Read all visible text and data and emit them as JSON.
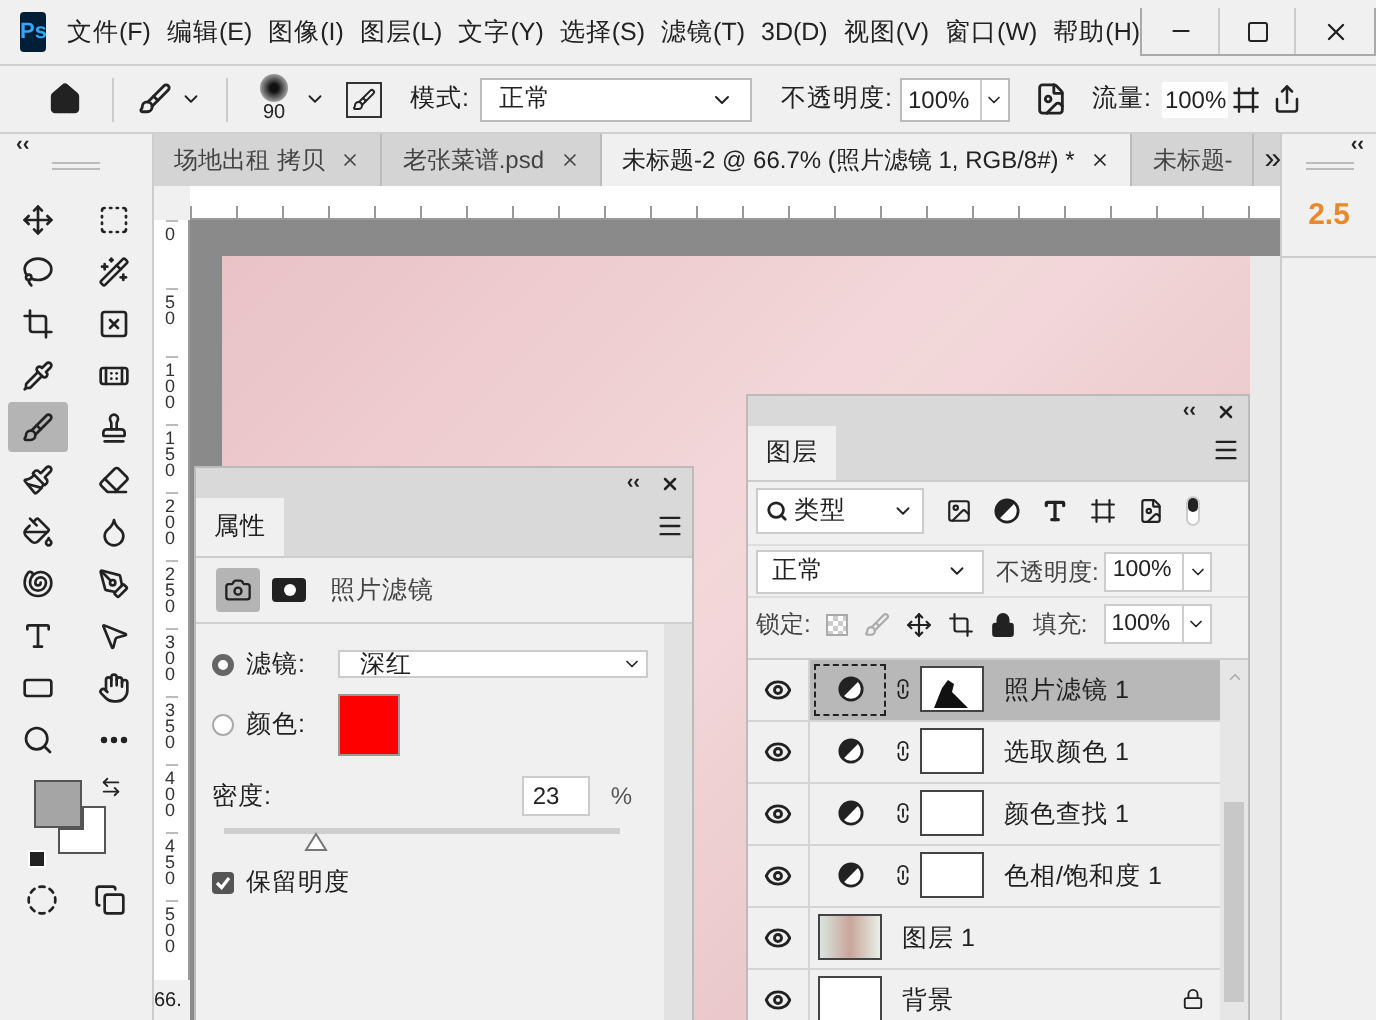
{
  "app_logo": "Ps",
  "menu": [
    "文件(F)",
    "编辑(E)",
    "图像(I)",
    "图层(L)",
    "文字(Y)",
    "选择(S)",
    "滤镜(T)",
    "3D(D)",
    "视图(V)",
    "窗口(W)",
    "帮助(H)"
  ],
  "options_bar": {
    "brush_size": "90",
    "mode_label": "模式:",
    "mode_value": "正常",
    "opacity_label": "不透明度:",
    "opacity_value": "100%",
    "flow_label": "流量:",
    "flow_value": "100%"
  },
  "tabs": [
    {
      "label": "场地出租 拷贝",
      "selected": false
    },
    {
      "label": "老张菜谱.psd",
      "selected": false
    },
    {
      "label": "未标题-2 @ 66.7% (照片滤镜 1, RGB/8#) *",
      "selected": true
    },
    {
      "label": "未标题-",
      "selected": false
    }
  ],
  "tabs_overflow": "»",
  "collapse_glyph": "‹‹",
  "right_panel_value": "2.5",
  "tools": [
    {
      "kind": "move",
      "selected": false
    },
    {
      "kind": "marquee",
      "selected": false
    },
    {
      "kind": "lasso",
      "selected": false
    },
    {
      "kind": "wand",
      "selected": false
    },
    {
      "kind": "crop",
      "selected": false
    },
    {
      "kind": "frame",
      "selected": false
    },
    {
      "kind": "eyedropper",
      "selected": false
    },
    {
      "kind": "healing",
      "selected": false
    },
    {
      "kind": "brush",
      "selected": true
    },
    {
      "kind": "stamp",
      "selected": false
    },
    {
      "kind": "history",
      "selected": false
    },
    {
      "kind": "eraser",
      "selected": false
    },
    {
      "kind": "bucket",
      "selected": false
    },
    {
      "kind": "blur",
      "selected": false
    },
    {
      "kind": "dodge",
      "selected": false
    },
    {
      "kind": "pen",
      "selected": false
    },
    {
      "kind": "type",
      "selected": false
    },
    {
      "kind": "pointer",
      "selected": false
    },
    {
      "kind": "rectangle",
      "selected": false
    },
    {
      "kind": "hand",
      "selected": false
    },
    {
      "kind": "zoom",
      "selected": false
    },
    {
      "kind": "more",
      "selected": false
    }
  ],
  "color_swatches": [
    {
      "kind": "foreground",
      "color": "#a5a5a5"
    },
    {
      "kind": "background",
      "color": "#ffffff"
    }
  ],
  "ruler_labels": [
    "0",
    "50",
    "100",
    "150",
    "200",
    "250",
    "300",
    "350",
    "400",
    "450",
    "500"
  ],
  "zoom_status": "66.",
  "properties_panel": {
    "tab": "属性",
    "title": "照片滤镜",
    "filter_option": {
      "label": "滤镜:",
      "selected": true,
      "value": "深红"
    },
    "color_option": {
      "label": "颜色:",
      "selected": false,
      "color": "#ff0000"
    },
    "density_label": "密度:",
    "density_value": "23",
    "density_unit": "%",
    "level": 0.23,
    "preserve_luminosity": {
      "label": "保留明度",
      "checked": true
    }
  },
  "layers_panel": {
    "tab": "图层",
    "filter_value": "类型",
    "blend_mode": "正常",
    "opacity_label": "不透明度:",
    "opacity_value": "100%",
    "lock_label": "锁定:",
    "fill_label": "填充:",
    "fill_value": "100%",
    "layers": [
      {
        "name": "照片滤镜 1",
        "kind": "adjustment",
        "mask_painted": true,
        "visible": true,
        "selected": true
      },
      {
        "name": "选取颜色 1",
        "kind": "adjustment",
        "mask_painted": false,
        "visible": true,
        "selected": false
      },
      {
        "name": "颜色查找 1",
        "kind": "adjustment",
        "mask_painted": false,
        "visible": true,
        "selected": false
      },
      {
        "name": "色相/饱和度 1",
        "kind": "adjustment",
        "mask_painted": false,
        "visible": true,
        "selected": false
      },
      {
        "name": "图层 1",
        "kind": "photo",
        "visible": true,
        "selected": false
      },
      {
        "name": "背景",
        "kind": "background",
        "visible": true,
        "selected": false
      }
    ]
  }
}
